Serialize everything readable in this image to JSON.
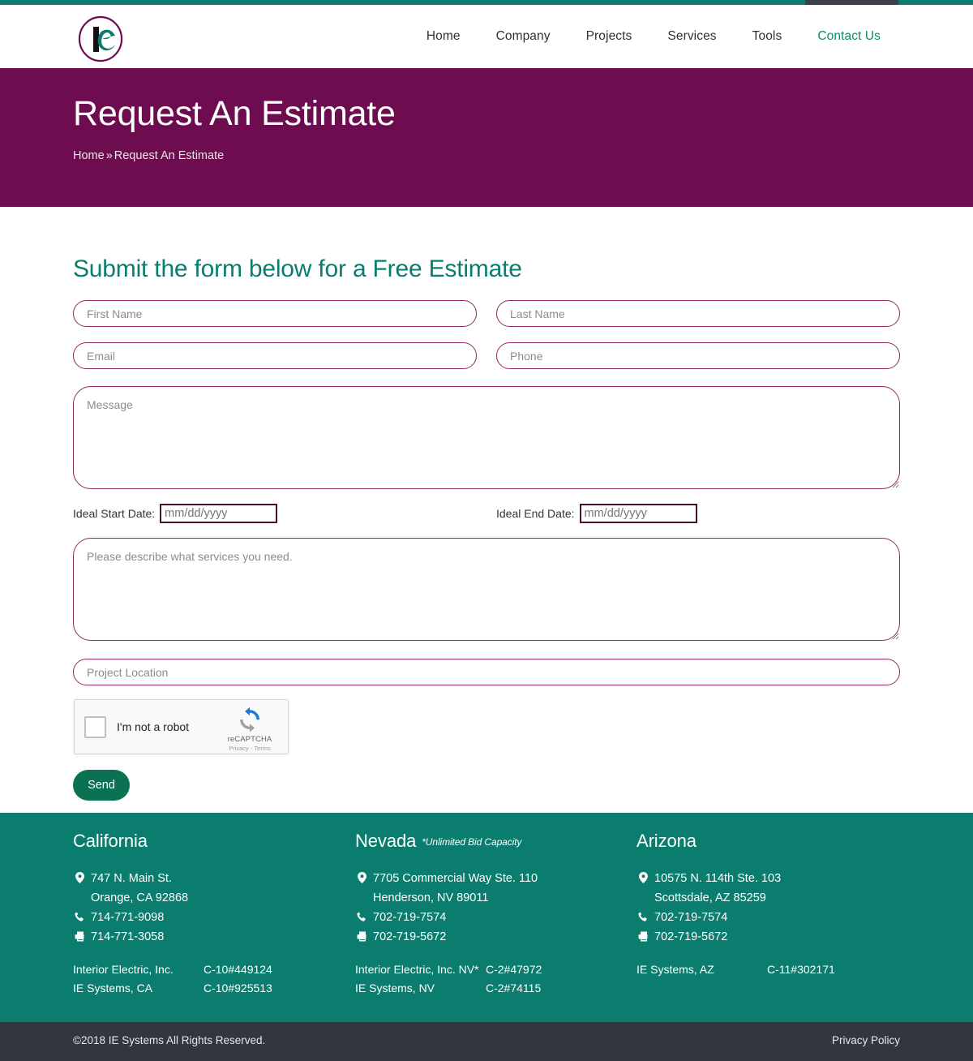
{
  "header": {
    "logo_alt": "IE Systems logo",
    "nav": [
      {
        "label": "Home",
        "active": false
      },
      {
        "label": "Company",
        "active": false
      },
      {
        "label": "Projects",
        "active": false
      },
      {
        "label": "Services",
        "active": false
      },
      {
        "label": "Tools",
        "active": false
      },
      {
        "label": "Contact Us",
        "active": true
      }
    ]
  },
  "hero": {
    "title": "Request An Estimate",
    "breadcrumb_home": "Home",
    "breadcrumb_sep": "»",
    "breadcrumb_current": "Request An Estimate"
  },
  "form": {
    "heading": "Submit the form below for a Free Estimate",
    "first_name_placeholder": "First Name",
    "last_name_placeholder": "Last Name",
    "email_placeholder": "Email",
    "phone_placeholder": "Phone",
    "message_placeholder": "Message",
    "start_date_label": "Ideal Start Date:",
    "start_date_placeholder": "mm/dd/yyyy",
    "end_date_label": "Ideal End Date:",
    "end_date_placeholder": "mm/dd/yyyy",
    "services_placeholder": "Please describe what services you need.",
    "location_placeholder": "Project Location",
    "submit_label": "Send"
  },
  "recaptcha": {
    "label": "I'm not a robot",
    "brand": "reCAPTCHA",
    "terms": "Privacy - Terms"
  },
  "footer": {
    "columns": [
      {
        "state": "California",
        "note": "",
        "address1": "747 N. Main St.",
        "address2": "Orange, CA 92868",
        "phone": "714-771-9098",
        "fax": "714-771-3058",
        "licenses": [
          {
            "name": "Interior Electric, Inc.",
            "number": "C-10#449124"
          },
          {
            "name": "IE Systems, CA",
            "number": "C-10#925513"
          }
        ]
      },
      {
        "state": "Nevada",
        "note": "*Unlimited Bid Capacity",
        "address1": "7705 Commercial Way Ste. 110",
        "address2": "Henderson, NV 89011",
        "phone": "702-719-7574",
        "fax": "702-719-5672",
        "licenses": [
          {
            "name": "Interior Electric, Inc. NV*",
            "number": "C-2#47972"
          },
          {
            "name": "IE Systems, NV",
            "number": "C-2#74115"
          }
        ]
      },
      {
        "state": "Arizona",
        "note": "",
        "address1": "10575 N. 114th Ste. 103",
        "address2": "Scottsdale, AZ 85259",
        "phone": "702-719-7574",
        "fax": "702-719-5672",
        "licenses": [
          {
            "name": "IE Systems, AZ",
            "number": "C-11#302171"
          }
        ]
      }
    ]
  },
  "bottom": {
    "copyright": "©2018 IE Systems All Rights Reserved.",
    "privacy_label": "Privacy Policy"
  },
  "colors": {
    "teal": "#0a7d6e",
    "purple": "#6e0c50",
    "field_border": "#8e2a63",
    "dark_bar": "#32363e",
    "send_green": "#0a7153"
  }
}
